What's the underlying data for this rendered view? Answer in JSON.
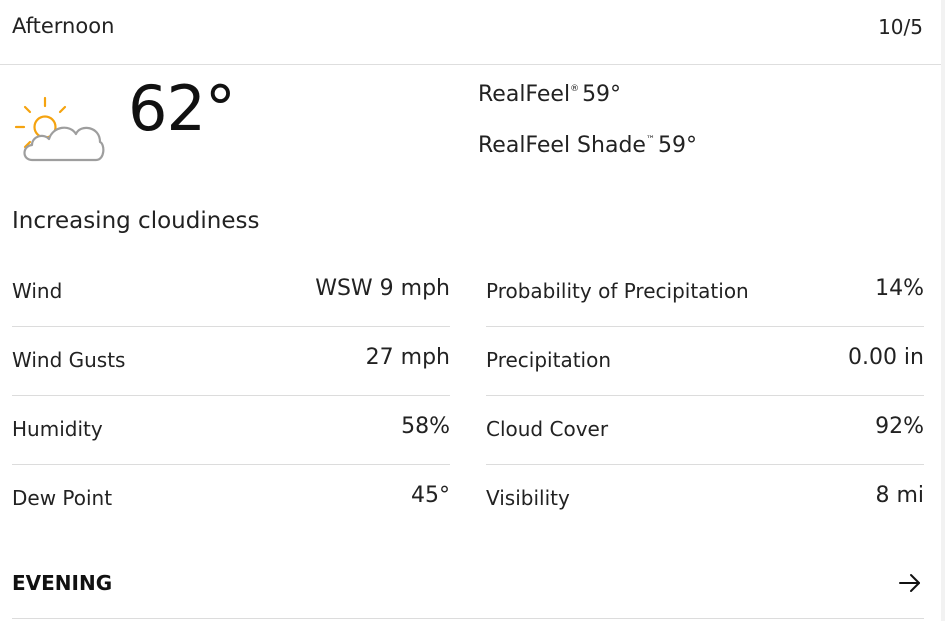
{
  "header": {
    "period": "Afternoon",
    "date": "10/5"
  },
  "current": {
    "icon": "partly-sunny-cloud-icon",
    "temperature": "62°",
    "realfeel_label": "RealFeel",
    "realfeel_mark": "®",
    "realfeel_value": "59°",
    "realfeel_shade_label": "RealFeel Shade",
    "realfeel_shade_mark": "™",
    "realfeel_shade_value": "59°",
    "phrase": "Increasing cloudiness"
  },
  "details_left": [
    {
      "label": "Wind",
      "value": "WSW 9 mph"
    },
    {
      "label": "Wind Gusts",
      "value": "27 mph"
    },
    {
      "label": "Humidity",
      "value": "58%"
    },
    {
      "label": "Dew Point",
      "value": "45°"
    }
  ],
  "details_right": [
    {
      "label": "Probability of Precipitation",
      "value": "14%"
    },
    {
      "label": "Precipitation",
      "value": "0.00 in"
    },
    {
      "label": "Cloud Cover",
      "value": "92%"
    },
    {
      "label": "Visibility",
      "value": "8 mi"
    }
  ],
  "next_period": {
    "label": "EVENING",
    "icon": "arrow-right-icon"
  },
  "colors": {
    "sun": "#f5a30f",
    "cloud_stroke": "#9e9e9e",
    "divider": "#dcdcdc"
  }
}
